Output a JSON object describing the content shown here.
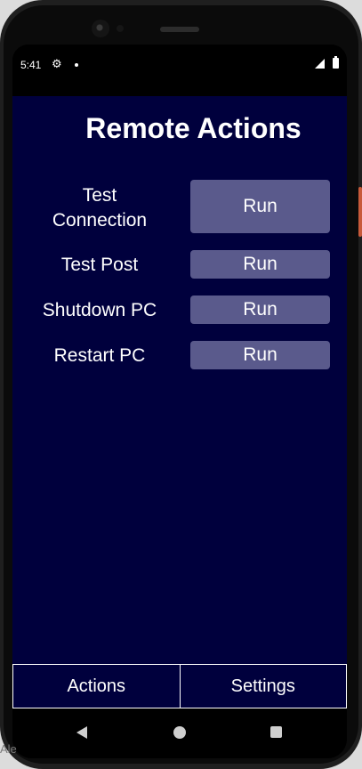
{
  "status_bar": {
    "time": "5:41",
    "settings_icon": "gear-icon",
    "signal_icon": "signal-icon",
    "battery_icon": "battery-icon"
  },
  "app": {
    "title": "Remote Actions",
    "background_color": "#00003d",
    "button_color": "#5a5a8c",
    "actions": [
      {
        "label": "Test\nConnection",
        "button_label": "Run"
      },
      {
        "label": "Test Post",
        "button_label": "Run"
      },
      {
        "label": "Shutdown PC",
        "button_label": "Run"
      },
      {
        "label": "Restart PC",
        "button_label": "Run"
      }
    ]
  },
  "tabs": [
    {
      "label": "Actions"
    },
    {
      "label": "Settings"
    }
  ],
  "nav_bar": {
    "back_icon": "back-icon",
    "home_icon": "home-icon",
    "recents_icon": "recents-icon"
  },
  "background_text": "Ale"
}
